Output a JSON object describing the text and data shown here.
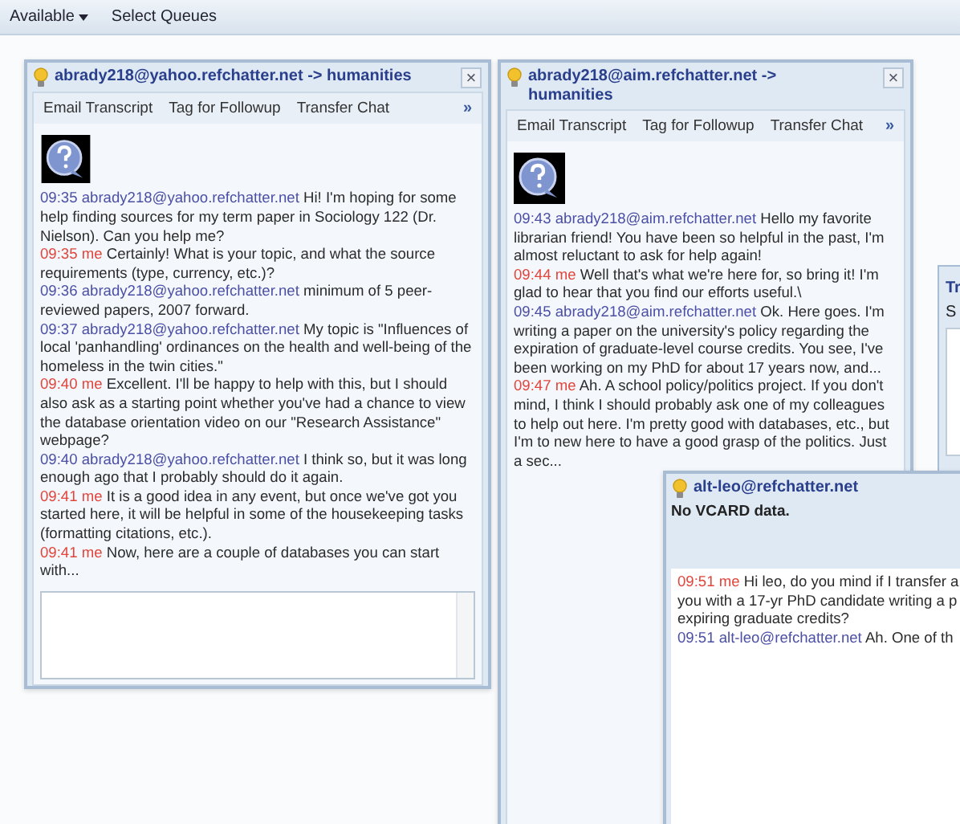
{
  "top_bar": {
    "status": "Available",
    "menu": "Select Queues"
  },
  "chats": [
    {
      "title": "abrady218@yahoo.refchatter.net -> humanities",
      "close": "×",
      "toolbar": [
        "Email Transcript",
        "Tag for Followup",
        "Transfer Chat"
      ],
      "more": "»",
      "input": true,
      "messages": [
        {
          "kind": "other",
          "time": "09:35",
          "sender": "abrady218@yahoo.refchatter.net",
          "text": "Hi! I'm hoping for some help finding sources for my term paper in Sociology 122 (Dr. Nielson). Can you help me?"
        },
        {
          "kind": "me",
          "time": "09:35",
          "sender": "me",
          "text": "Certainly! What is your topic, and what the source requirements (type, currency, etc.)?"
        },
        {
          "kind": "other",
          "time": "09:36",
          "sender": "abrady218@yahoo.refchatter.net",
          "text": "minimum of 5 peer-reviewed papers, 2007 forward."
        },
        {
          "kind": "other",
          "time": "09:37",
          "sender": "abrady218@yahoo.refchatter.net",
          "text": "My topic is \"Influences of local 'panhandling' ordinances on the health and well-being of the homeless in the twin cities.\""
        },
        {
          "kind": "me",
          "time": "09:40",
          "sender": "me",
          "text": "Excellent. I'll be happy to help with this, but I should also ask as a starting point whether you've had a chance to view the database orientation video on our \"Research Assistance\" webpage?"
        },
        {
          "kind": "other",
          "time": "09:40",
          "sender": "abrady218@yahoo.refchatter.net",
          "text": "I think so, but it was long enough ago that I probably should do it again."
        },
        {
          "kind": "me",
          "time": "09:41",
          "sender": "me",
          "text": "It is a good idea in any event, but once we've got you started here, it will be helpful in some of the housekeeping tasks (formatting citations, etc.)."
        },
        {
          "kind": "me",
          "time": "09:41",
          "sender": "me",
          "text": "Now, here are a couple of databases you can start with..."
        }
      ]
    },
    {
      "title": "abrady218@aim.refchatter.net -> humanities",
      "close": "×",
      "toolbar": [
        "Email Transcript",
        "Tag for Followup",
        "Transfer Chat"
      ],
      "more": "»",
      "input": false,
      "messages": [
        {
          "kind": "other",
          "time": "09:43",
          "sender": "abrady218@aim.refchatter.net",
          "text": "Hello my favorite librarian friend! You have been so helpful in the past, I'm almost reluctant to ask for help again!"
        },
        {
          "kind": "me",
          "time": "09:44",
          "sender": "me",
          "text": "Well that's what we're here for, so bring it! I'm glad to hear that you find our efforts useful.\\"
        },
        {
          "kind": "other",
          "time": "09:45",
          "sender": "abrady218@aim.refchatter.net",
          "text": "Ok. Here goes. I'm writing a paper on the university's policy regarding the expiration of graduate-level course credits. You see, I've been working on my PhD for about 17 years now, and..."
        },
        {
          "kind": "me",
          "time": "09:47",
          "sender": "me",
          "text": "Ah. A school policy/politics project. If you don't mind, I think I should probably ask one of my colleagues to help out here. I'm pretty good with databases, etc., but I'm to new here to have a good grasp of the politics. Just a sec..."
        }
      ]
    }
  ],
  "back_panel": {
    "title": "Tr",
    "label": "S"
  },
  "transfer_chat": {
    "title": "alt-leo@refchatter.net",
    "vcard": "No VCARD data.",
    "messages": [
      {
        "kind": "me",
        "time": "09:51",
        "sender": "me",
        "lines": [
          "Hi leo, do you mind if I transfer a",
          "you with a 17-yr PhD candidate writing a p",
          "expiring graduate credits?"
        ]
      },
      {
        "kind": "other",
        "time": "09:51",
        "sender": "alt-leo@refchatter.net",
        "lines": [
          "Ah. One of th"
        ]
      }
    ]
  }
}
